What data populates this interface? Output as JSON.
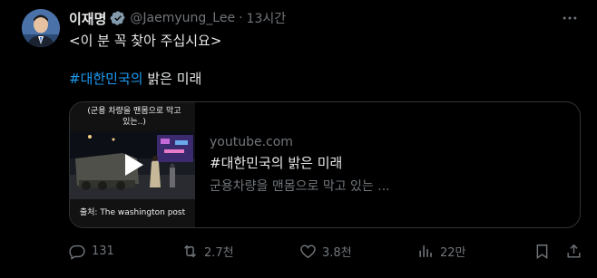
{
  "tweet": {
    "author": {
      "display_name": "이재명",
      "handle": "@Jaemyung_Lee",
      "verified": true,
      "avatar_icon": "profile-photo"
    },
    "separator": "·",
    "time": "13시간",
    "more_icon": "more-dots-icon",
    "line1": "<이 분 꼭 찾아 주십시요>",
    "hashtag": "#대한민국의",
    "line2_rest": " 밝은 미래",
    "card": {
      "thumbnail_caption_top": "(군용 차량을 맨몸으로 막고있는..)",
      "thumbnail_caption_bottom": "출처: The washington post",
      "domain": "youtube.com",
      "title": "#대한민국의 밝은 미래",
      "description": "군용차량을 맨몸으로 막고 있는 ..."
    },
    "actions": {
      "replies": "131",
      "reposts": "2.7천",
      "likes": "3.8천",
      "views": "22만"
    }
  },
  "colors": {
    "background": "#000000",
    "text": "#e7e9ea",
    "muted": "#71767b",
    "accent": "#1d9bf0",
    "border": "#2f3336"
  }
}
